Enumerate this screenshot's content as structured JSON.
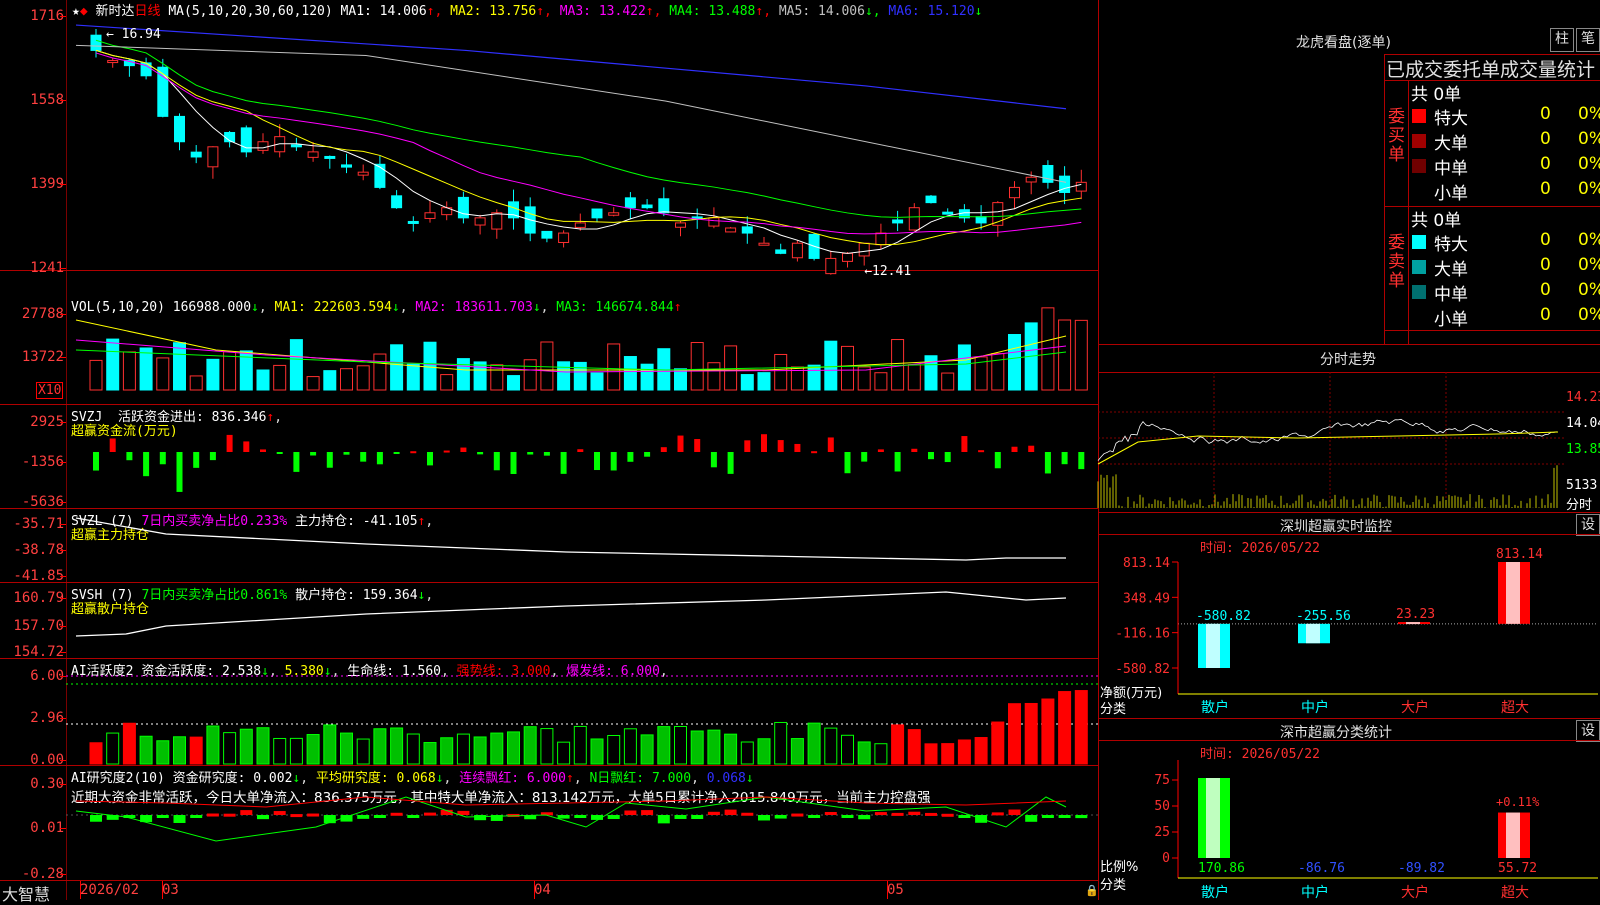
{
  "main": {
    "title": "新时达",
    "period": "日线",
    "ma_label": "MA(5,10,20,30,60,120)",
    "ma": [
      {
        "name": "MA1:",
        "val": "14.006",
        "arrow": "↑",
        "color": "#ffffff"
      },
      {
        "name": "MA2:",
        "val": "13.756",
        "arrow": "↑",
        "color": "#ffff00"
      },
      {
        "name": "MA3:",
        "val": "13.422",
        "arrow": "↑",
        "color": "#ff00ff"
      },
      {
        "name": "MA4:",
        "val": "13.488",
        "arrow": "↑",
        "color": "#00ff00"
      },
      {
        "name": "MA5:",
        "val": "14.006",
        "arrow": "↓",
        "color": "#c0c0c0"
      },
      {
        "name": "MA6:",
        "val": "15.120",
        "arrow": "↓",
        "color": "#3030ff"
      }
    ],
    "ylabels": [
      "1716",
      "1558",
      "1399",
      "1241"
    ],
    "high_label": "16.94",
    "low_label": "12.41"
  },
  "vol": {
    "label": "VOL(5,10,20)",
    "val": "166988.000",
    "ma1": "MA1: 222603.594",
    "ma2": "MA2: 183611.703",
    "ma3": "MA3: 146674.844",
    "ylabels": [
      "27788",
      "13722"
    ],
    "unit": "X10"
  },
  "svzj": {
    "label": "SVZJ",
    "desc": "活跃资金进出: 836.346",
    "sub": "超赢资金流(万元)",
    "ylabels": [
      "2925",
      "-1356",
      "-5636"
    ]
  },
  "svzl": {
    "label": "SVZL (7)",
    "desc1": "7日内买卖净占比0.233%",
    "desc2": "主力持仓: -41.105",
    "sub": "超赢主力持仓",
    "ylabels": [
      "-35.71",
      "-38.78",
      "-41.85"
    ]
  },
  "svsh": {
    "label": "SVSH (7)",
    "desc1": "7日内买卖净占比0.861%",
    "desc2": "散户持仓: 159.364",
    "sub": "超赢散户持仓",
    "ylabels": [
      "160.79",
      "157.70",
      "154.72"
    ]
  },
  "ai1": {
    "label": "AI活跃度2",
    "desc": "资金活跃度: 2.538",
    "v2": "5.380",
    "life": "生命线: 1.560",
    "strong": "强势线: 3.000",
    "burst": "爆发线: 6.000",
    "ylabels": [
      "6.00",
      "2.96",
      "0.00"
    ]
  },
  "ai2": {
    "label": "AI研究度2(10)",
    "desc": "资金研究度: 0.002",
    "avg": "平均研究度: 0.068",
    "cont": "连续飘红: 6.000",
    "nday": "N日飘红: 7.000",
    "last": "0.068",
    "note": "近期大资金非常活跃，今日大单净流入：836.375万元，其中特大单净流入：813.142万元，大单5日累计净入2015.849万元，当前主力控盘强",
    "ylabels": [
      "0.30",
      "0.01",
      "-0.28"
    ]
  },
  "xaxis": {
    "brand": "大智慧",
    "labels": [
      "2026/02",
      "03",
      "04",
      "05"
    ]
  },
  "longhu": {
    "title": "龙虎看盘(逐单)",
    "btn1": "柱",
    "btn2": "笔",
    "header": "已成交委托单成交量统计",
    "buy_label": "委买单",
    "sell_label": "委卖单",
    "buy_total": "共 0单",
    "sell_total": "共 0单",
    "buy_rows": [
      {
        "name": "特大",
        "v": "0",
        "p": "0%",
        "color": "#ff0000"
      },
      {
        "name": "大单",
        "v": "0",
        "p": "0%",
        "color": "#a00000"
      },
      {
        "name": "中单",
        "v": "0",
        "p": "0%",
        "color": "#700000"
      },
      {
        "name": "小单",
        "v": "0",
        "p": "0%",
        "color": "#000000"
      }
    ],
    "sell_rows": [
      {
        "name": "特大",
        "v": "0",
        "p": "0%",
        "color": "#00ffff"
      },
      {
        "name": "大单",
        "v": "0",
        "p": "0%",
        "color": "#00a0a0"
      },
      {
        "name": "中单",
        "v": "0",
        "p": "0%",
        "color": "#007070"
      },
      {
        "name": "小单",
        "v": "0",
        "p": "0%",
        "color": "#000000"
      }
    ]
  },
  "fenshi": {
    "title": "分时走势",
    "ylabels": [
      "14.23",
      "14.04",
      "13.85"
    ],
    "vol": "5133",
    "vol_label": "分时"
  },
  "monitor": {
    "title": "深圳超赢实时监控",
    "btn": "设",
    "time": "时间: 2026/05/22",
    "ylabels": [
      "813.14",
      "348.49",
      "-116.16",
      "-580.82"
    ],
    "ylabel": "净额(万元)",
    "xlabel_cat": "分类",
    "cats": [
      "散户",
      "中户",
      "大户",
      "超大"
    ],
    "values": [
      "-580.82",
      "-255.56",
      "23.23",
      "813.14"
    ]
  },
  "stats": {
    "title": "深市超赢分类统计",
    "btn": "设",
    "time": "时间: 2026/05/22",
    "ylabels": [
      "75",
      "50",
      "25",
      "0"
    ],
    "ylabel": "比例%",
    "xlabel_cat": "分类",
    "cats": [
      "散户",
      "中户",
      "大户",
      "超大"
    ],
    "values": [
      "170.86",
      "-86.76",
      "-89.82",
      "55.72"
    ],
    "pct": "+0.11%"
  }
}
